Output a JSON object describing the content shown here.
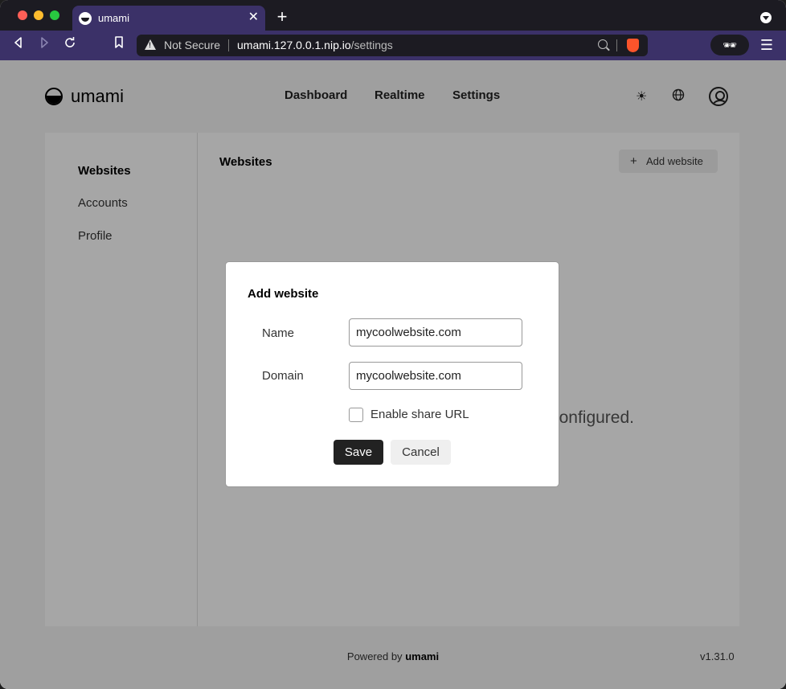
{
  "browser": {
    "tab_title": "umami",
    "tab_close": "✕",
    "new_tab": "+",
    "security_label": "Not Secure",
    "url_host": "umami.127.0.0.1.nip.io",
    "url_path": "/settings"
  },
  "app": {
    "logo_text": "umami",
    "nav": [
      "Dashboard",
      "Realtime",
      "Settings"
    ],
    "sidebar": [
      "Websites",
      "Accounts",
      "Profile"
    ],
    "section_title": "Websites",
    "add_website_label": "Add website",
    "background_message": "onfigured.",
    "footer_powered_prefix": "Powered by",
    "footer_brand": "umami",
    "version": "v1.31.0"
  },
  "modal": {
    "title": "Add website",
    "name_label": "Name",
    "name_value": "mycoolwebsite.com",
    "domain_label": "Domain",
    "domain_value": "mycoolwebsite.com",
    "share_url_label": "Enable share URL",
    "share_url_checked": false,
    "save_label": "Save",
    "cancel_label": "Cancel"
  }
}
